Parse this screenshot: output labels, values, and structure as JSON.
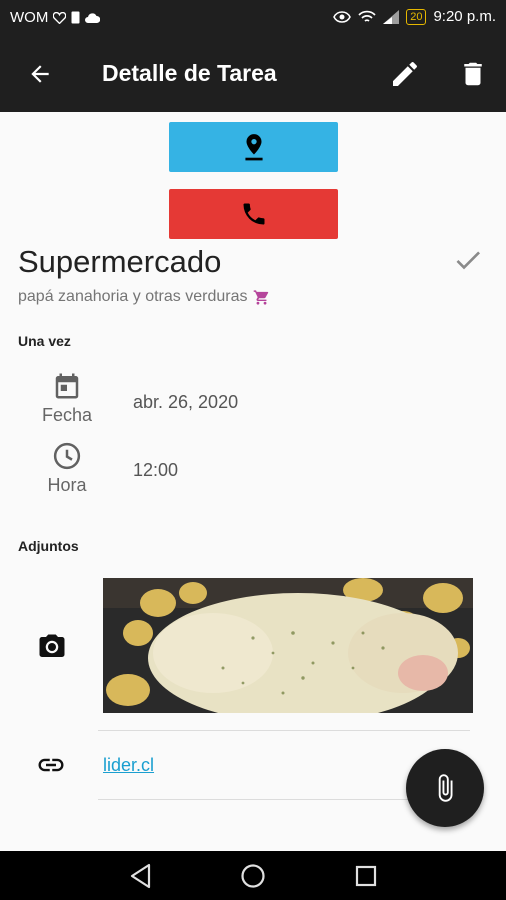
{
  "statusbar": {
    "carrier": "WOM",
    "battery_level": "20",
    "time": "9:20 p.m."
  },
  "appbar": {
    "title": "Detalle de Tarea",
    "back_icon": "arrow-back-icon",
    "edit_icon": "pencil-icon",
    "delete_icon": "trash-icon"
  },
  "actions": {
    "location_color": "#35b3e4",
    "call_color": "#e53935"
  },
  "task": {
    "title": "Supermercado",
    "description": "papá zanahoria y otras verduras",
    "done_icon": "check-icon",
    "category_icon": "shopping-cart-icon",
    "category_color": "#b5449b"
  },
  "schedule": {
    "section_label": "Una vez",
    "date_label": "Fecha",
    "date_value": "abr. 26, 2020",
    "time_label": "Hora",
    "time_value": "12:00"
  },
  "attachments": {
    "section_label": "Adjuntos",
    "link_text": "lider.cl"
  }
}
